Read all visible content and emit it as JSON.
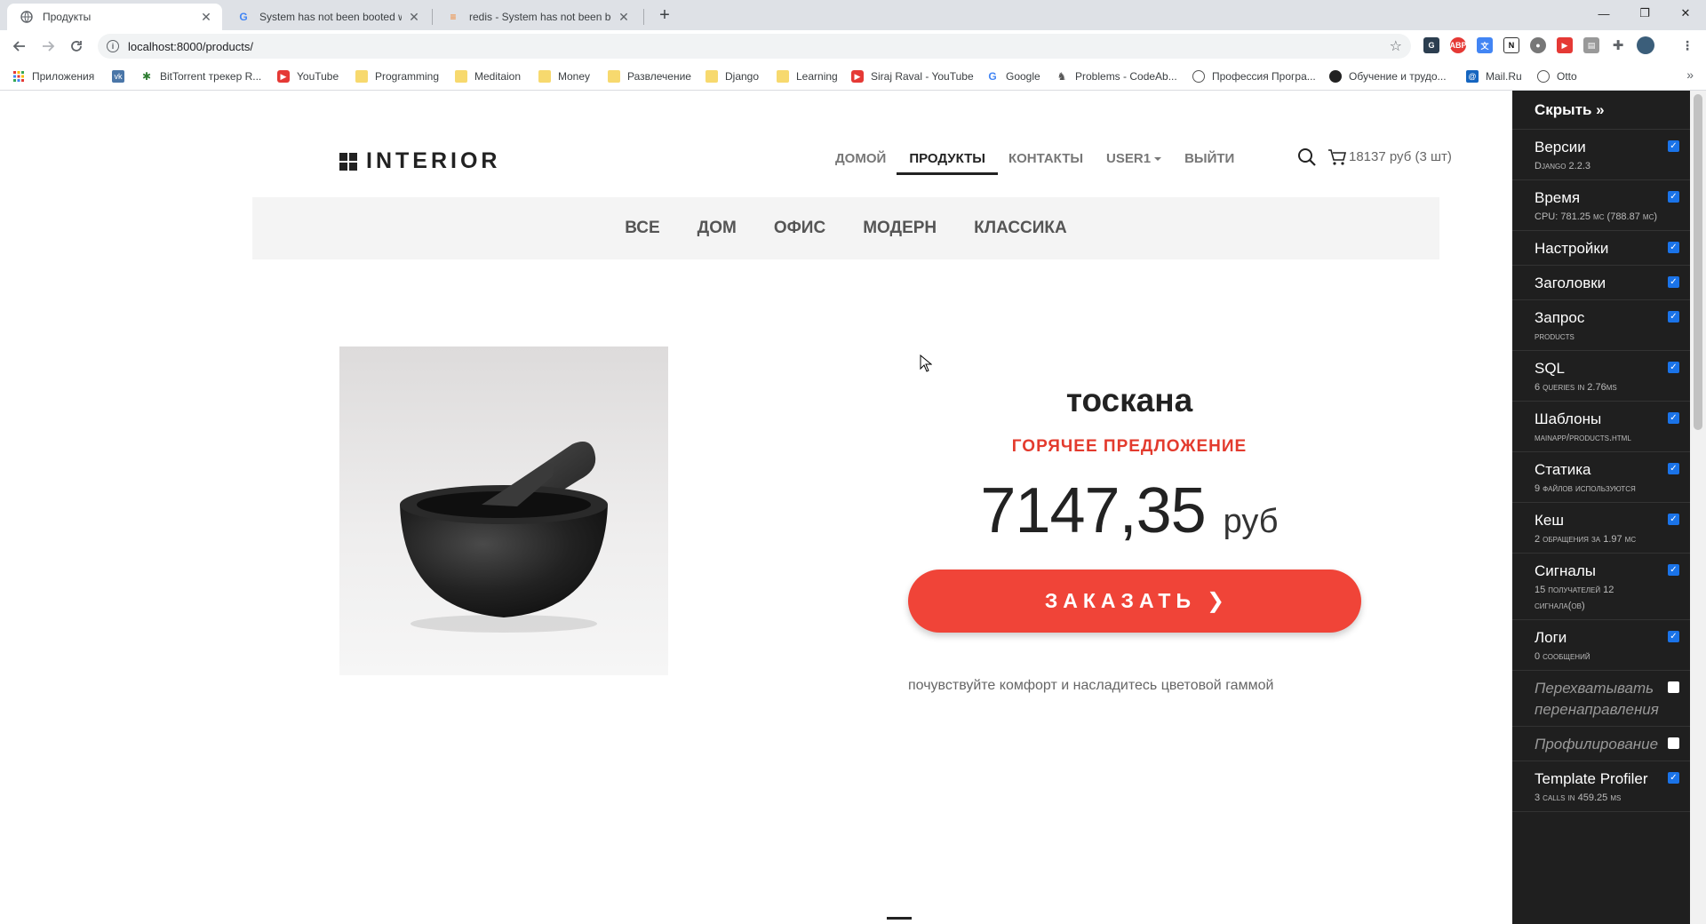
{
  "browser": {
    "tabs": [
      {
        "title": "Продукты",
        "active": true
      },
      {
        "title": "System has not been booted wit"
      },
      {
        "title": "redis - System has not been boo"
      }
    ],
    "new_tab": "+",
    "url": "localhost:8000/products/",
    "window_controls": {
      "minimize": "—",
      "restore": "❐",
      "close": "✕"
    }
  },
  "bookmarks": [
    {
      "label": "Приложения",
      "icon": "apps-icon"
    },
    {
      "label": "",
      "icon": "vk-icon"
    },
    {
      "label": "BitTorrent трекер R...",
      "icon": "rutracker-icon"
    },
    {
      "label": "YouTube",
      "icon": "youtube-icon"
    },
    {
      "label": "Programming",
      "icon": "folder-icon"
    },
    {
      "label": "Meditaion",
      "icon": "folder-icon"
    },
    {
      "label": "Money",
      "icon": "folder-icon"
    },
    {
      "label": "Развлечение",
      "icon": "folder-icon"
    },
    {
      "label": "Django",
      "icon": "folder-icon"
    },
    {
      "label": "Learning",
      "icon": "folder-icon"
    },
    {
      "label": "Siraj Raval - YouTube",
      "icon": "youtube-icon"
    },
    {
      "label": "Google",
      "icon": "google-icon"
    },
    {
      "label": "Problems - CodeAb...",
      "icon": "codeabbey-icon"
    },
    {
      "label": "Профессия Програ...",
      "icon": "site-icon"
    },
    {
      "label": "Обучение и трудо...",
      "icon": "site-icon"
    },
    {
      "label": "Mail.Ru",
      "icon": "mailru-icon"
    },
    {
      "label": "Otto",
      "icon": "site-icon"
    }
  ],
  "site": {
    "logo": "INTERIOR",
    "nav": {
      "home": "ДОМОЙ",
      "products": "ПРОДУКТЫ",
      "contacts": "КОНТАКТЫ",
      "user": "USER1",
      "logout": "ВЫЙТИ"
    },
    "cart": "18137 руб (3 шт)",
    "categories": [
      "ВСЕ",
      "ДОМ",
      "ОФИС",
      "МОДЕРН",
      "КЛАССИКА"
    ]
  },
  "product": {
    "title": "тоскана",
    "badge": "ГОРЯЧЕЕ ПРЕДЛОЖЕНИЕ",
    "price": "7147,35",
    "currency": "руб",
    "order_button": "ЗАКАЗАТЬ",
    "tagline": "почувствуйте комфорт и насладитесь цветовой гаммой"
  },
  "debug_toolbar": {
    "hide": "Скрыть »",
    "panels": [
      {
        "title": "Версии",
        "sub": "Django 2.2.3",
        "checked": true
      },
      {
        "title": "Время",
        "sub": "CPU: 781.25 мс (788.87 мс)",
        "checked": true
      },
      {
        "title": "Настройки",
        "sub": "",
        "checked": true
      },
      {
        "title": "Заголовки",
        "sub": "",
        "checked": true
      },
      {
        "title": "Запрос",
        "sub": "products",
        "checked": true
      },
      {
        "title": "SQL",
        "sub": "6 queries in 2.76ms",
        "checked": true
      },
      {
        "title": "Шаблоны",
        "sub": "mainapp/products.html",
        "checked": true
      },
      {
        "title": "Статика",
        "sub": "9 файлов используются",
        "checked": true
      },
      {
        "title": "Кеш",
        "sub": "2 обращения за 1.97 мс",
        "checked": true
      },
      {
        "title": "Сигналы",
        "sub": "15 получателей 12 сигнала(ов)",
        "checked": true
      },
      {
        "title": "Логи",
        "sub": "0 сообщений",
        "checked": true
      },
      {
        "title": "Перехватывать перенаправления",
        "sub": "",
        "checked": false
      },
      {
        "title": "Профилирование",
        "sub": "",
        "checked": false
      },
      {
        "title": "Template Profiler",
        "sub": "3 calls in 459.25 ms",
        "checked": true
      }
    ]
  },
  "colors": {
    "accent": "#f04438",
    "hot": "#e33b2e",
    "toolbar_bg": "#1f1f1f"
  }
}
